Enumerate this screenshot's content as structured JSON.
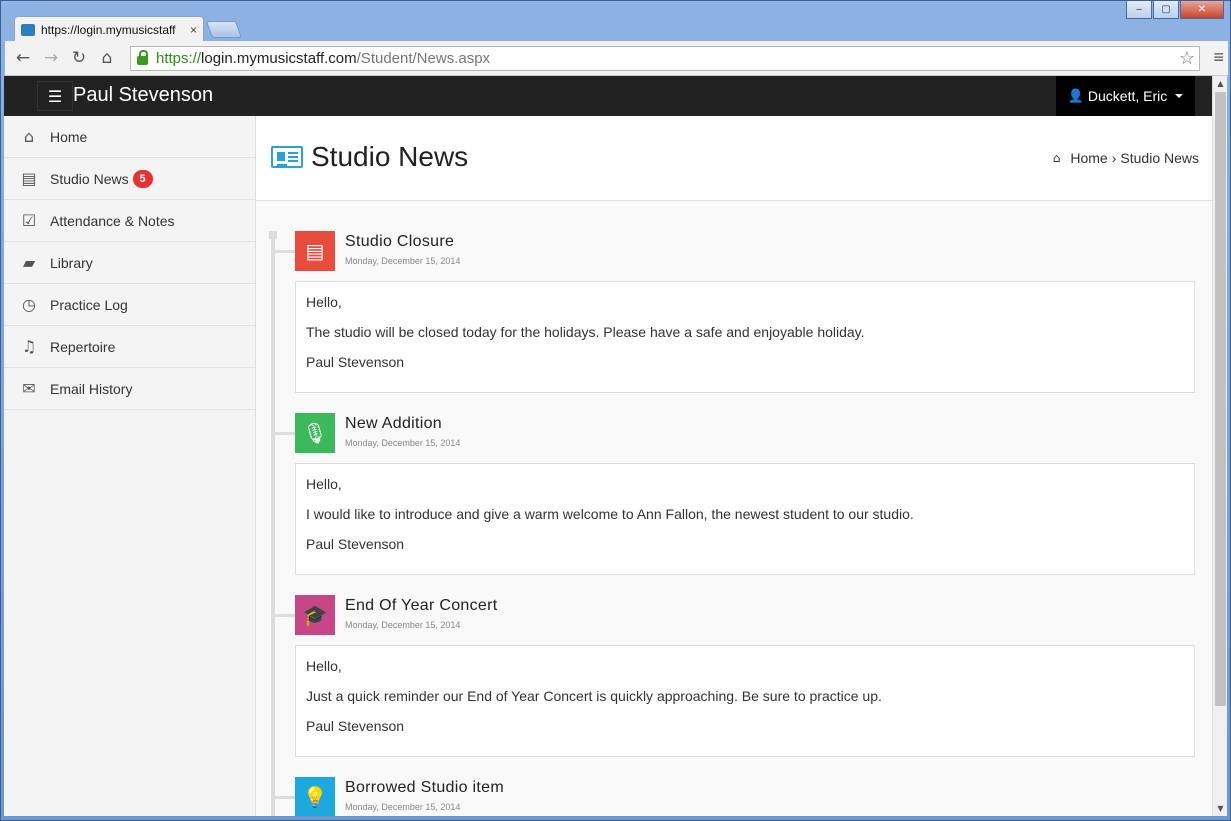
{
  "browser": {
    "tab_title": "https://login.mymusicstaff",
    "tab_close": "×",
    "url_scheme": "https://",
    "url_host": "login.mymusicstaff.com",
    "url_path": "/Student/News.aspx",
    "win_min": "‒",
    "win_max": "▢",
    "win_close": "✕"
  },
  "appbar": {
    "brand": "Paul Stevenson",
    "user_name": "Duckett, Eric",
    "menu_icon": "☰"
  },
  "sidebar": {
    "items": [
      {
        "label": "Home",
        "icon": "home-icon",
        "glyph": "⌂"
      },
      {
        "label": "Studio News",
        "icon": "newspaper-icon",
        "glyph": "▤",
        "badge": "5"
      },
      {
        "label": "Attendance & Notes",
        "icon": "checkbox-icon",
        "glyph": "☑"
      },
      {
        "label": "Library",
        "icon": "book-icon",
        "glyph": "▰"
      },
      {
        "label": "Practice Log",
        "icon": "clock-icon",
        "glyph": "◷"
      },
      {
        "label": "Repertoire",
        "icon": "music-note-icon",
        "glyph": "♫"
      },
      {
        "label": "Email History",
        "icon": "envelope-icon",
        "glyph": "✉"
      }
    ]
  },
  "page": {
    "title": "Studio News",
    "breadcrumb": {
      "home": "Home",
      "separator": "›",
      "current": "Studio News"
    }
  },
  "news": [
    {
      "title": "Studio Closure",
      "date": "Monday, December 15, 2014",
      "icon": "newspaper-icon",
      "glyph": "▤",
      "color": "#e84c3d",
      "lines": [
        "Hello,",
        "The studio will be closed today for the holidays. Please have a safe and enjoyable holiday.",
        "Paul Stevenson"
      ]
    },
    {
      "title": "New Addition",
      "date": "Monday, December 15, 2014",
      "icon": "microphone-icon",
      "glyph": "🎙",
      "color": "#3cb95a",
      "lines": [
        "Hello,",
        "I would like to introduce and give a warm welcome to Ann Fallon, the newest student to our studio.",
        "Paul Stevenson"
      ]
    },
    {
      "title": "End Of Year Concert",
      "date": "Monday, December 15, 2014",
      "icon": "graduation-cap-icon",
      "glyph": "🎓",
      "color": "#c64688",
      "lines": [
        "Hello,",
        "Just a quick reminder our End of Year Concert is quickly approaching. Be sure to practice up.",
        "Paul Stevenson"
      ]
    },
    {
      "title": "Borrowed Studio item",
      "date": "Monday, December 15, 2014",
      "icon": "lightbulb-icon",
      "glyph": "💡",
      "color": "#1ea8e0",
      "lines": []
    }
  ]
}
